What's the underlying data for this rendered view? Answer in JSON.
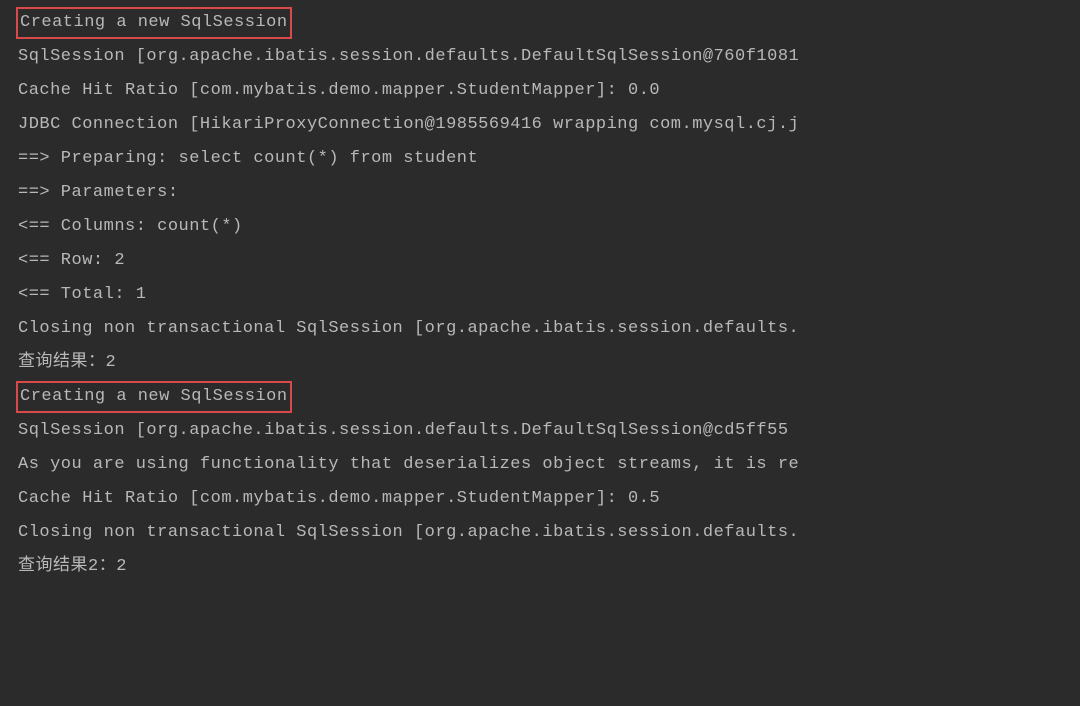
{
  "lines": [
    {
      "text": "Creating a new SqlSession",
      "hl": true
    },
    {
      "text": "SqlSession [org.apache.ibatis.session.defaults.DefaultSqlSession@760f1081"
    },
    {
      "text": "Cache Hit Ratio [com.mybatis.demo.mapper.StudentMapper]: 0.0"
    },
    {
      "text": "JDBC Connection [HikariProxyConnection@1985569416 wrapping com.mysql.cj.j"
    },
    {
      "text": "==>  Preparing: select count(*) from student"
    },
    {
      "text": "==> Parameters: "
    },
    {
      "text": "<==    Columns: count(*)"
    },
    {
      "text": "<==        Row: 2"
    },
    {
      "text": "<==      Total: 1"
    },
    {
      "text": "Closing non transactional SqlSession [org.apache.ibatis.session.defaults."
    },
    {
      "text": "查询结果：2"
    },
    {
      "text": "Creating a new SqlSession",
      "hl": true
    },
    {
      "text": "SqlSession [org.apache.ibatis.session.defaults.DefaultSqlSession@cd5ff55"
    },
    {
      "text": "As you are using functionality that deserializes object streams, it is re"
    },
    {
      "text": "Cache Hit Ratio [com.mybatis.demo.mapper.StudentMapper]: 0.5"
    },
    {
      "text": "Closing non transactional SqlSession [org.apache.ibatis.session.defaults."
    },
    {
      "text": "查询结果2：2"
    }
  ]
}
